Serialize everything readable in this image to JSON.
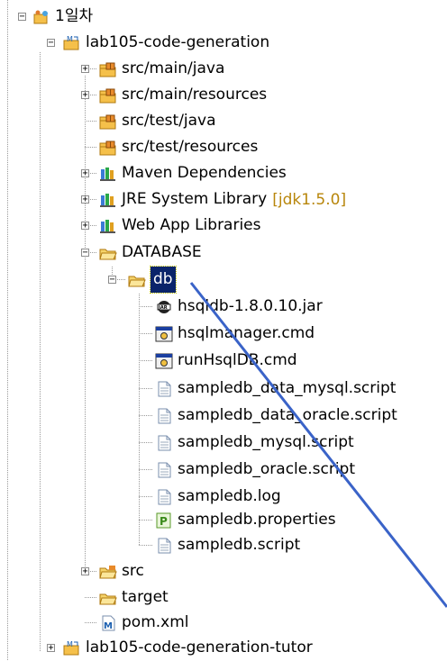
{
  "tree": {
    "root": "1일차",
    "project": "lab105-code-generation",
    "items": [
      {
        "label": "src/main/java"
      },
      {
        "label": "src/main/resources"
      },
      {
        "label": "src/test/java"
      },
      {
        "label": "src/test/resources"
      },
      {
        "label": "Maven Dependencies"
      },
      {
        "label": "JRE System Library",
        "decoration": "[jdk1.5.0]"
      },
      {
        "label": "Web App Libraries"
      },
      {
        "label": "DATABASE"
      },
      {
        "label": "db"
      },
      {
        "label": "hsqldb-1.8.0.10.jar"
      },
      {
        "label": "hsqlmanager.cmd"
      },
      {
        "label": "runHsqlDB.cmd"
      },
      {
        "label": "sampledb_data_mysql.script"
      },
      {
        "label": "sampledb_data_oracle.script"
      },
      {
        "label": "sampledb_mysql.script"
      },
      {
        "label": "sampledb_oracle.script"
      },
      {
        "label": "sampledb.log"
      },
      {
        "label": "sampledb.properties"
      },
      {
        "label": "sampledb.script"
      },
      {
        "label": "src"
      },
      {
        "label": "target"
      },
      {
        "label": "pom.xml"
      }
    ],
    "next_project": "lab105-code-generation-tutor"
  },
  "icons": {
    "folder": "folder-icon",
    "package_folder": "source-folder-icon",
    "library": "library-icon",
    "file": "file-icon",
    "cmd": "cmd-icon",
    "jar": "jar-icon",
    "properties": "properties-icon",
    "pom": "maven-pom-icon"
  },
  "colors": {
    "selection": "#0a246a",
    "annotation_arrow": "#3a63c8",
    "decoration": "#b8860b"
  }
}
